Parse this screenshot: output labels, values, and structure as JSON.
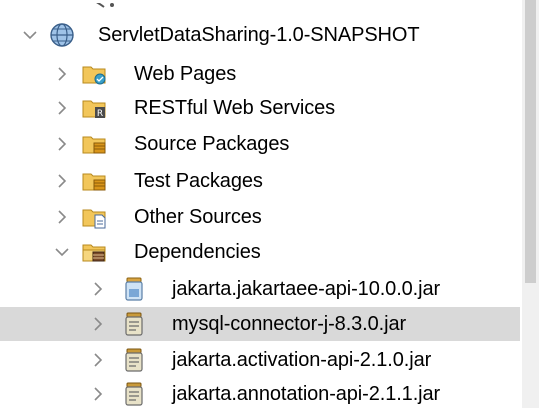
{
  "tree": {
    "project": {
      "label": "ServletDataSharing-1.0-SNAPSHOT",
      "icon": "globe-project-icon",
      "expanded": true
    },
    "nodes": [
      {
        "label": "Web Pages",
        "icon": "web-pages-folder-icon",
        "expanded": false
      },
      {
        "label": "RESTful Web Services",
        "icon": "restful-folder-icon",
        "expanded": false
      },
      {
        "label": "Source Packages",
        "icon": "source-packages-folder-icon",
        "expanded": false
      },
      {
        "label": "Test Packages",
        "icon": "test-packages-folder-icon",
        "expanded": false
      },
      {
        "label": "Other Sources",
        "icon": "other-sources-folder-icon",
        "expanded": false
      },
      {
        "label": "Dependencies",
        "icon": "dependencies-folder-icon",
        "expanded": true
      }
    ],
    "dependencies": [
      {
        "label": "jakarta.jakartaee-api-10.0.0.jar",
        "icon": "jar-icon",
        "selected": false
      },
      {
        "label": "mysql-connector-j-8.3.0.jar",
        "icon": "jar-icon",
        "selected": true
      },
      {
        "label": "jakarta.activation-api-2.1.0.jar",
        "icon": "jar-icon",
        "selected": false
      },
      {
        "label": "jakarta.annotation-api-2.1.1.jar",
        "icon": "jar-icon",
        "selected": false
      }
    ]
  },
  "colors": {
    "selection": "#d9d9d9",
    "folder": "#e8b74a",
    "chevron": "#8a8a8a"
  }
}
